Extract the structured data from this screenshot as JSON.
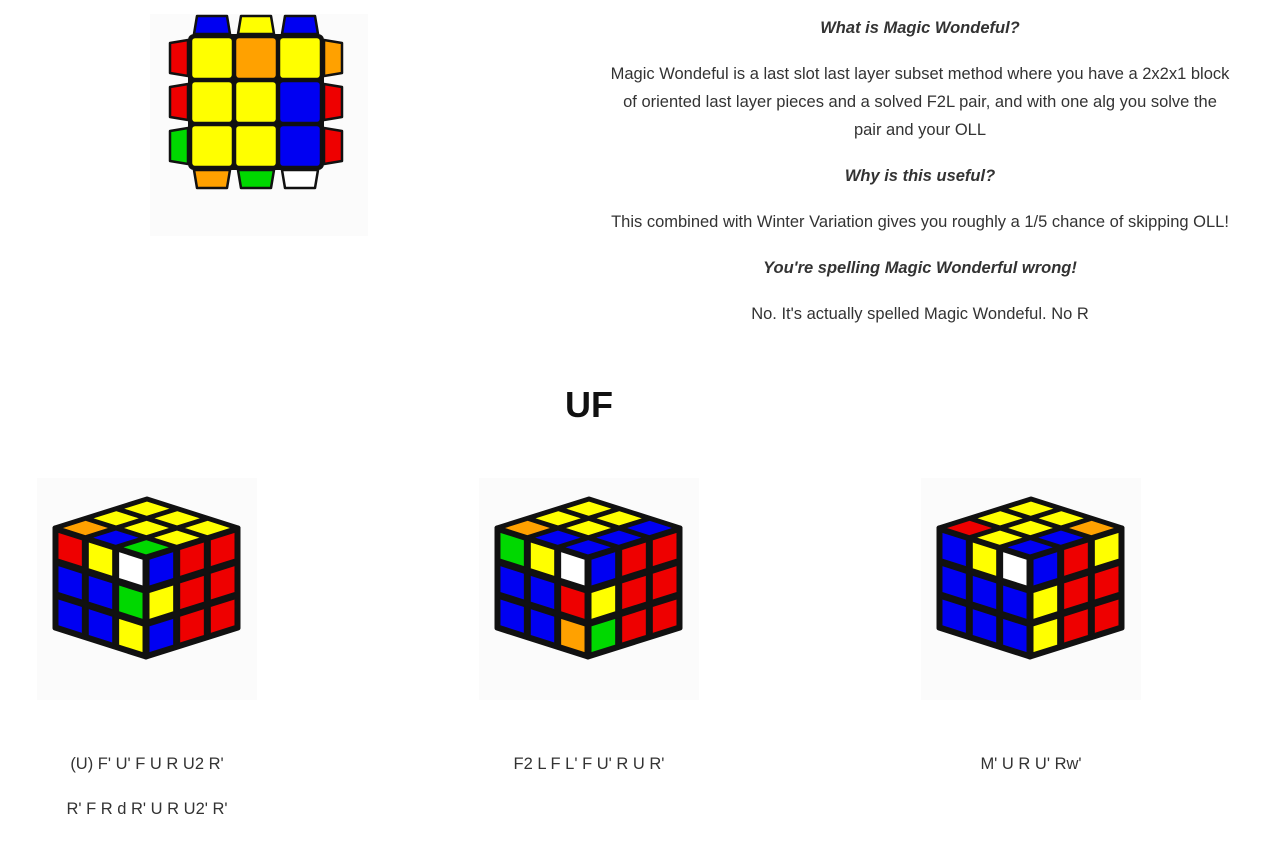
{
  "faq": {
    "q1": "What is Magic Wondeful?",
    "a1": "Magic Wondeful is a last slot last layer subset method where you have a 2x2x1 block of oriented last layer pieces and a solved F2L pair, and with one alg you solve the pair and your OLL",
    "q2": "Why is this useful?",
    "a2": "This combined with Winter Variation gives you roughly a 1/5 chance of skipping OLL!",
    "q3": "You're spelling Magic Wonderful wrong!",
    "a3": "No. It's actually spelled Magic Wondeful. No R"
  },
  "section": {
    "title": "UF"
  },
  "colors": {
    "Y": "#ffff00",
    "B": "#0000f2",
    "R": "#ee0000",
    "O": "#ffa100",
    "G": "#00d800",
    "W": "#ffffff",
    "outline": "#111111"
  },
  "top_view": {
    "top_edge": [
      "B",
      "Y",
      "B"
    ],
    "left_edge": [
      "R",
      "R",
      "G"
    ],
    "right_edge": [
      "O",
      "R",
      "R"
    ],
    "bottom_edge": [
      "O",
      "G",
      "W"
    ],
    "grid": [
      [
        "Y",
        "O",
        "Y"
      ],
      [
        "Y",
        "Y",
        "B"
      ],
      [
        "Y",
        "Y",
        "B"
      ]
    ]
  },
  "cases": [
    {
      "name": "case-1",
      "algs": [
        "(U) F' U' F U R U2 R'",
        "R' F R d R' U R U2' R'"
      ],
      "top": [
        [
          "Y",
          "Y",
          "Y"
        ],
        [
          "Y",
          "Y",
          "Y"
        ],
        [
          "O",
          "B",
          "G"
        ]
      ],
      "front": [
        [
          "R",
          "Y",
          "W"
        ],
        [
          "B",
          "B",
          "G"
        ],
        [
          "B",
          "B",
          "Y"
        ]
      ],
      "right": [
        [
          "B",
          "R",
          "R"
        ],
        [
          "Y",
          "R",
          "R"
        ],
        [
          "B",
          "R",
          "R"
        ]
      ]
    },
    {
      "name": "case-2",
      "algs": [
        "F2 L F L' F U' R U R'"
      ],
      "top": [
        [
          "Y",
          "Y",
          "B"
        ],
        [
          "Y",
          "Y",
          "B"
        ],
        [
          "O",
          "B",
          "B"
        ]
      ],
      "front": [
        [
          "G",
          "Y",
          "W"
        ],
        [
          "B",
          "B",
          "R"
        ],
        [
          "B",
          "B",
          "O"
        ]
      ],
      "right": [
        [
          "B",
          "R",
          "R"
        ],
        [
          "Y",
          "R",
          "R"
        ],
        [
          "G",
          "R",
          "R"
        ]
      ]
    },
    {
      "name": "case-3",
      "algs": [
        "M' U R U' Rw'"
      ],
      "top": [
        [
          "Y",
          "Y",
          "O"
        ],
        [
          "Y",
          "Y",
          "B"
        ],
        [
          "R",
          "Y",
          "B"
        ]
      ],
      "front": [
        [
          "B",
          "Y",
          "W"
        ],
        [
          "B",
          "B",
          "B"
        ],
        [
          "B",
          "B",
          "B"
        ]
      ],
      "right": [
        [
          "B",
          "R",
          "Y"
        ],
        [
          "Y",
          "R",
          "R"
        ],
        [
          "Y",
          "R",
          "R"
        ]
      ]
    }
  ]
}
